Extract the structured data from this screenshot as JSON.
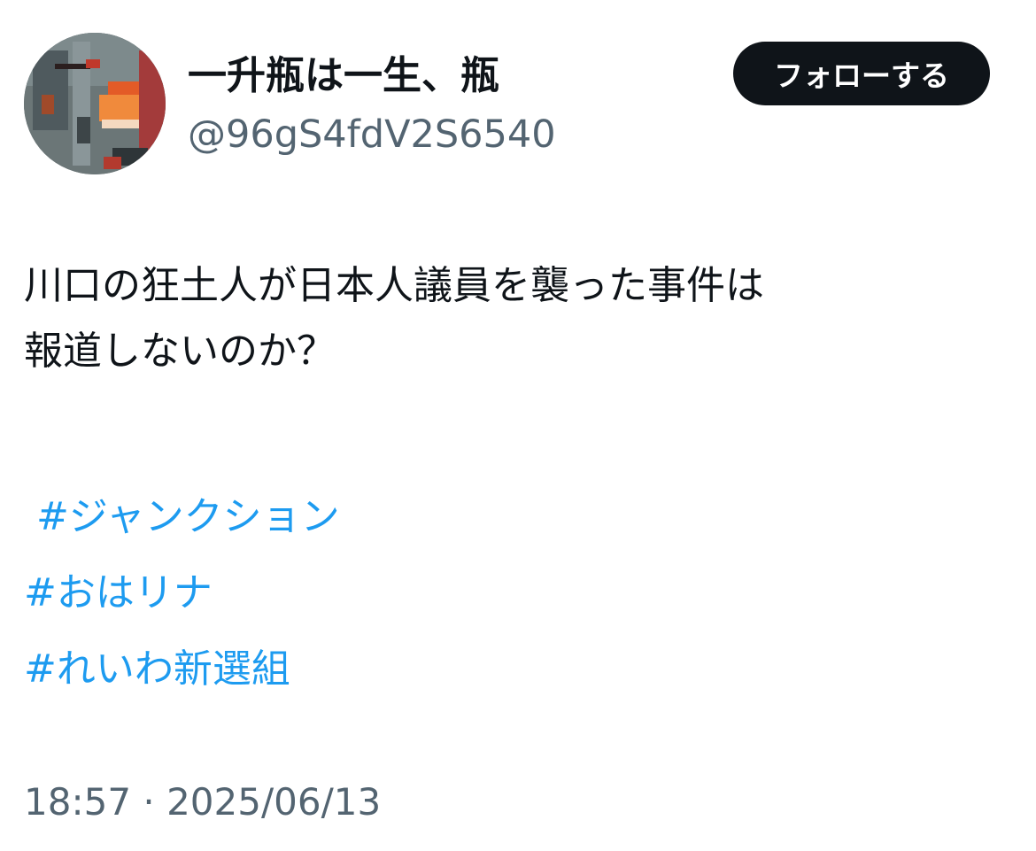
{
  "user": {
    "display_name": "一升瓶は一生、瓶",
    "handle": "@96gS4fdV2S6540",
    "avatar_icon": "abstract-painting-avatar"
  },
  "follow_button": {
    "label": "フォローする"
  },
  "tweet": {
    "lines": [
      "川口の狂土人が日本人議員を襲った事件は",
      "報道しないのか？"
    ],
    "hashtags": [
      "#ジャンクション",
      "#おはリナ",
      "#れいわ新選組"
    ],
    "timestamp": "18:57 · 2025/06/13"
  },
  "colors": {
    "text": "#0f1419",
    "secondary": "#536471",
    "link": "#1d9bf0",
    "button_bg": "#0f1419",
    "button_text": "#ffffff"
  }
}
